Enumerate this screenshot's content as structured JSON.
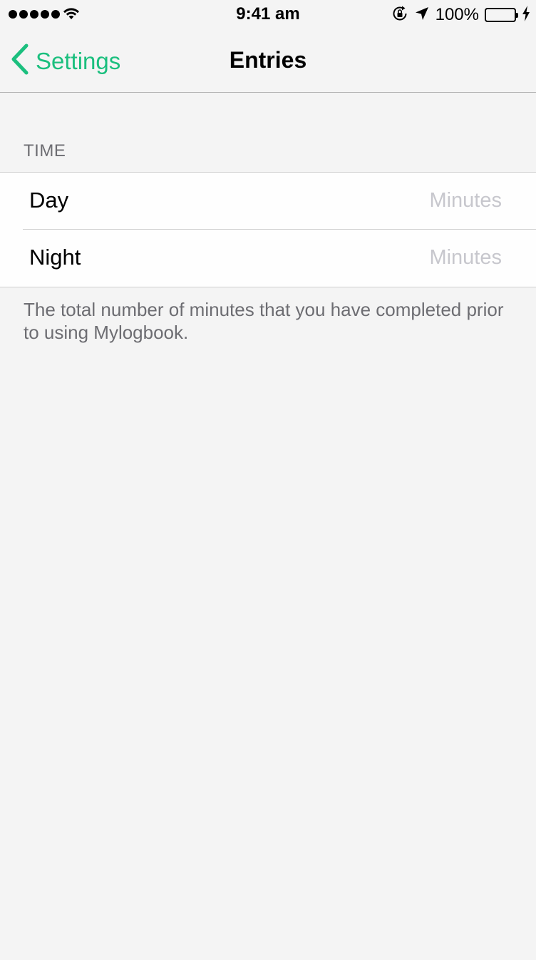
{
  "status_bar": {
    "time": "9:41 am",
    "battery_percent": "100%",
    "battery_level": 1.0,
    "signal_bars": 5,
    "icons": [
      "signal-dots",
      "wifi-icon",
      "rotation-lock-icon",
      "location-arrow-icon",
      "battery-icon",
      "charging-bolt-icon"
    ]
  },
  "nav": {
    "back_label": "Settings",
    "title": "Entries"
  },
  "section": {
    "header": "TIME",
    "rows": [
      {
        "label": "Day",
        "value": "",
        "placeholder": "Minutes"
      },
      {
        "label": "Night",
        "value": "",
        "placeholder": "Minutes"
      }
    ],
    "footer": "The total number of minutes that you have completed prior to using Mylogbook."
  },
  "colors": {
    "accent": "#1bbf7e",
    "background": "#f4f4f4",
    "cell_background": "#fefefe",
    "secondary_text": "#6d6d72",
    "placeholder": "#c7c7cd",
    "battery_fill": "#4cd964"
  }
}
